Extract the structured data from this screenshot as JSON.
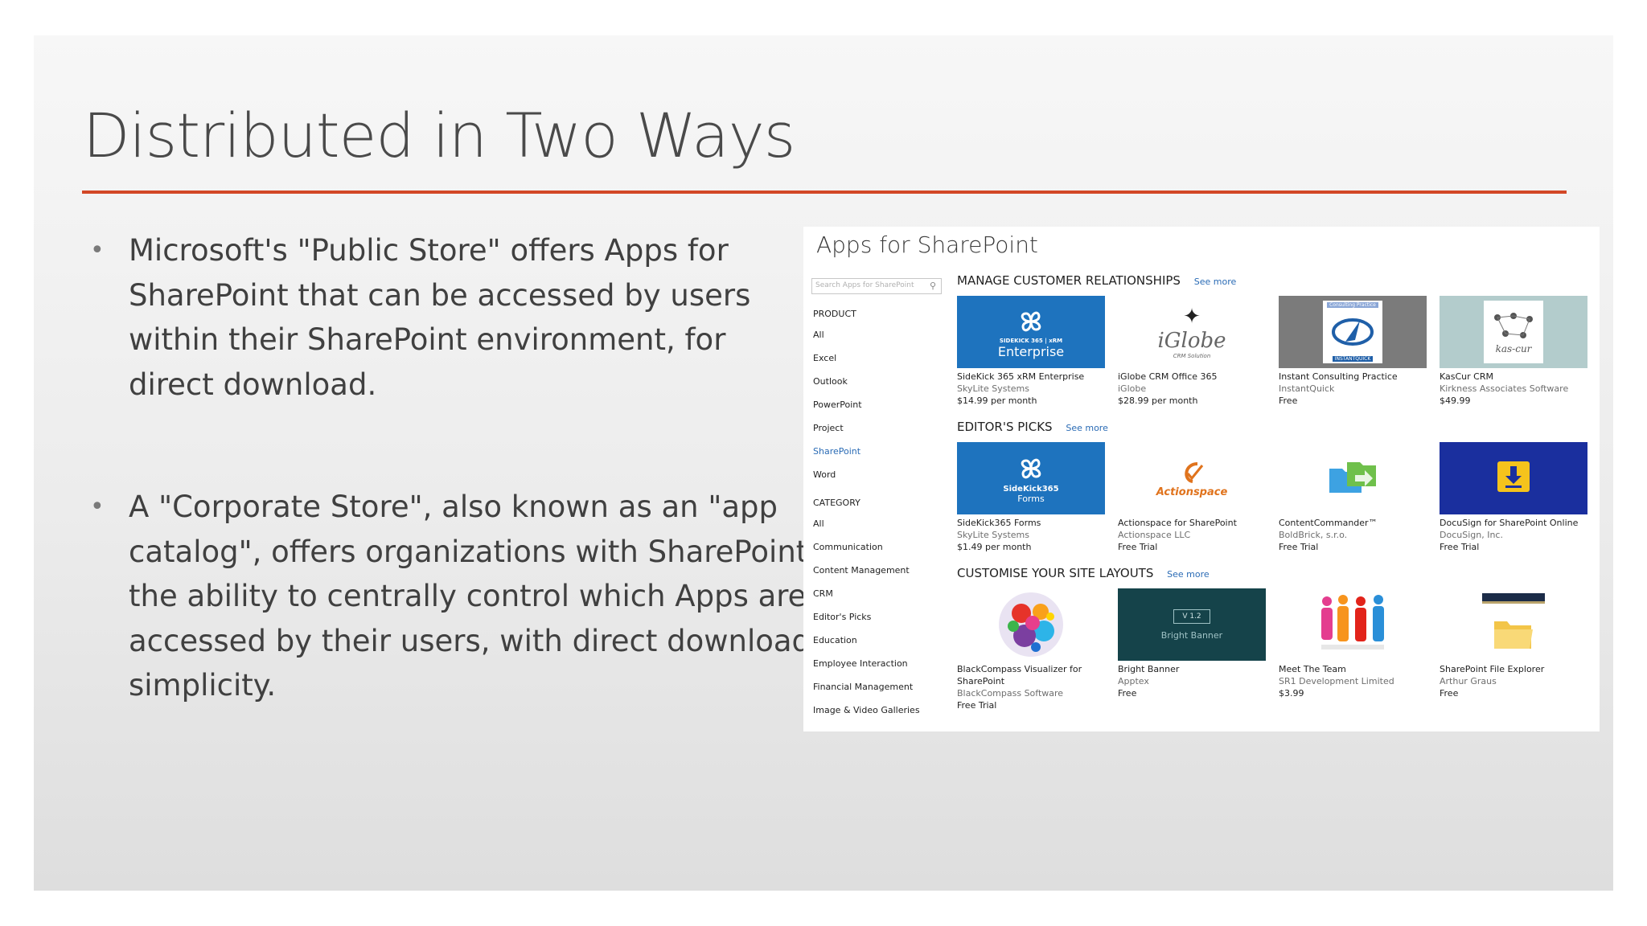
{
  "slide": {
    "title": "Distributed in Two Ways",
    "bullets": [
      {
        "marker": "•",
        "text": "Microsoft's \"Public Store\" offers Apps for SharePoint that can be accessed by users within their SharePoint environment, for direct download."
      },
      {
        "marker": "•",
        "text": "A \"Corporate Store\", also known as an \"app catalog\", offers organizations with SharePoint the ability to centrally control which Apps are accessed by their users, with direct download simplicity."
      }
    ]
  },
  "store": {
    "title": "Apps for SharePoint",
    "search_placeholder": "Search Apps for SharePoint",
    "sidebar": {
      "product_heading": "PRODUCT",
      "product_items": [
        "All",
        "Excel",
        "Outlook",
        "PowerPoint",
        "Project",
        "SharePoint",
        "Word"
      ],
      "active_product": "SharePoint",
      "category_heading": "CATEGORY",
      "category_items": [
        "All",
        "Communication",
        "Content Management",
        "CRM",
        "Editor's Picks",
        "Education",
        "Employee Interaction",
        "Financial Management",
        "Image & Video Galleries"
      ]
    },
    "see_more": "See more",
    "sections": [
      {
        "title": "MANAGE CUSTOMER RELATIONSHIPS",
        "apps": [
          {
            "name": "SideKick 365 xRM Enterprise",
            "publisher": "SkyLite Systems",
            "price": "$14.99 per month",
            "tile_text_small": "SIDEKICK 365 | xRM",
            "tile_text": "Enterprise",
            "bg": "#1e73be"
          },
          {
            "name": "iGlobe CRM Office 365",
            "publisher": "iGlobe",
            "price": "$28.99 per month",
            "tile_text": "iGlobe",
            "tile_text_small": "CRM Solution",
            "bg": "#ffffff"
          },
          {
            "name": "Instant Consulting Practice",
            "publisher": "InstantQuick",
            "price": "Free",
            "tile_text_small": "Consulting Practice",
            "tile_text": "INSTANTQUICK",
            "bg": "#7b7b7b"
          },
          {
            "name": "KasCur CRM",
            "publisher": "Kirkness Associates Software",
            "price": "$49.99",
            "tile_text": "kas-cur",
            "bg": "#b3cccc"
          }
        ]
      },
      {
        "title": "EDITOR'S PICKS",
        "apps": [
          {
            "name": "SideKick365 Forms",
            "publisher": "SkyLite Systems",
            "price": "$1.49 per month",
            "tile_text_small": "SideKick365",
            "tile_text": "Forms",
            "bg": "#1e73be"
          },
          {
            "name": "Actionspace for SharePoint",
            "publisher": "Actionspace LLC",
            "price": "Free Trial",
            "tile_text": "Actionspace",
            "bg": "#ffffff"
          },
          {
            "name": "ContentCommander™",
            "publisher": "BoldBrick, s.r.o.",
            "price": "Free Trial",
            "bg": "#ffffff"
          },
          {
            "name": "DocuSign for SharePoint Online",
            "publisher": "DocuSign, Inc.",
            "price": "Free Trial",
            "bg": "#1a2f9e"
          }
        ]
      },
      {
        "title": "CUSTOMISE YOUR SITE LAYOUTS",
        "apps": [
          {
            "name": "BlackCompass Visualizer for",
            "name2": "SharePoint",
            "publisher": "BlackCompass Software",
            "price": "Free Trial",
            "bg": "#ffffff"
          },
          {
            "name": "Bright Banner",
            "publisher": "Apptex",
            "price": "Free",
            "tile_text_small": "V 1.2",
            "tile_text": "Bright Banner",
            "bg": "#15434a"
          },
          {
            "name": "Meet The Team",
            "publisher": "SR1 Development Limited",
            "price": "$3.99",
            "bg": "#ffffff"
          },
          {
            "name": "SharePoint File Explorer",
            "publisher": "Arthur Graus",
            "price": "Free",
            "bg": "#ffffff"
          }
        ]
      }
    ]
  }
}
